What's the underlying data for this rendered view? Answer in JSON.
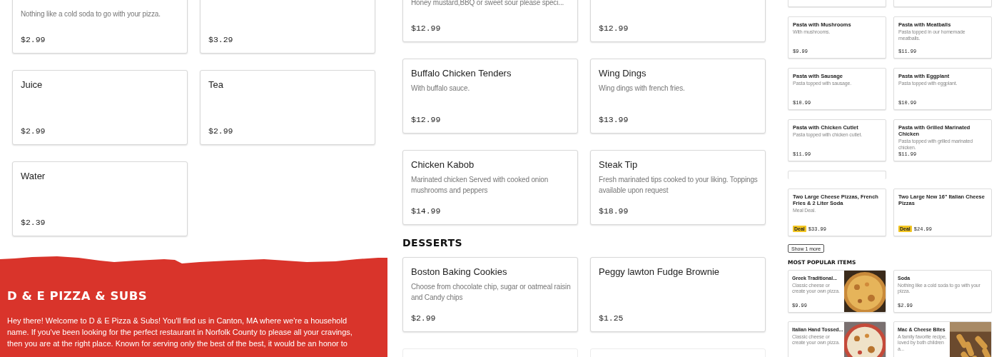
{
  "left": {
    "items": [
      {
        "description": "Nothing like a cold soda to go with your pizza.",
        "price": "$2.99"
      },
      {
        "price": "$3.29"
      },
      {
        "name": "Juice",
        "price": "$2.99"
      },
      {
        "name": "Tea",
        "price": "$2.99"
      },
      {
        "name": "Water",
        "price": "$2.39"
      }
    ],
    "about": {
      "title": "D & E PIZZA & SUBS",
      "text": "Hey there! Welcome to D & E Pizza & Subs! You'll find us in Canton, MA where we're a household name. If you've been looking for the perfect restaurant in Norfolk County to please all your cravings, then you are at the right place. Known for serving only the best of the best, it would be an honor to"
    }
  },
  "middle": {
    "groups": [
      {
        "items": [
          {
            "description": "Honey mustard,BBQ or sweet sour please speci...",
            "price": "$12.99"
          },
          {
            "price": "$12.99"
          },
          {
            "name": "Buffalo Chicken Tenders",
            "description": "With buffalo sauce.",
            "price": "$12.99"
          },
          {
            "name": "Wing Dings",
            "description": "Wing dings with french fries.",
            "price": "$13.99"
          },
          {
            "name": "Chicken Kabob",
            "description": "Marinated chicken Served with cooked onion mushrooms and peppers",
            "price": "$14.99"
          },
          {
            "name": "Steak Tip",
            "description": "Fresh marinated tips cooked to your liking. Toppings available upon request",
            "price": "$18.99"
          }
        ]
      },
      {
        "heading": "DESSERTS",
        "items": [
          {
            "name": "Boston Baking Cookies",
            "description": "Choose from chocolate chip, sugar or oatmeal raisin and Candy chips",
            "price": "$2.99"
          },
          {
            "name": "Peggy lawton Fudge Brownie",
            "price": "$1.25"
          },
          {
            "kind": "stub"
          },
          {
            "kind": "stub"
          }
        ]
      }
    ]
  },
  "right": {
    "items": [
      {
        "kind": "stub"
      },
      {
        "kind": "stub"
      },
      {
        "kind": "item",
        "name": "Pasta with Mushrooms",
        "description": "With mushrooms.",
        "price": "$9.99"
      },
      {
        "kind": "item",
        "name": "Pasta with Meatballs",
        "description": "Pasta topped in our homemade meatballs.",
        "price": "$11.99"
      },
      {
        "kind": "item",
        "name": "Pasta with Sausage",
        "description": "Pasta topped with sausage.",
        "price": "$10.99"
      },
      {
        "kind": "item",
        "name": "Pasta with Eggplant",
        "description": "Pasta topped with eggplant.",
        "price": "$10.99"
      },
      {
        "kind": "item",
        "name": "Pasta with Chicken Cutlet",
        "description": "Pasta topped with chicken cutlet.",
        "price": "$11.99"
      },
      {
        "kind": "item",
        "name": "Pasta with Grilled Marinated Chicken",
        "description": "Pasta topped with grilled marinated chicken.",
        "price": "$11.99"
      },
      {
        "kind": "stub"
      }
    ],
    "deals": [
      {
        "name": "Two Large Cheese Pizzas, French Fries & 2 Liter Soda",
        "description": "Meal Deal.",
        "badge": "Deal",
        "price": "$33.99"
      },
      {
        "name": "Two Large New 16\" Italian Cheese Pizzas",
        "badge": "Deal",
        "price": "$24.99"
      }
    ],
    "show_more": "Show 1 more",
    "popular": {
      "title": "MOST POPULAR ITEMS",
      "items": [
        {
          "name": "Greek Traditional...",
          "description": "Classic cheese or create your own pizza.",
          "price": "$9.99"
        },
        {
          "name": "Soda",
          "description": "Nothing like a cold soda to go with your pizza.",
          "price": "$2.99"
        },
        {
          "name": "Italian Hand Tossed...",
          "description": "Classic cheese or create your own pizza."
        },
        {
          "name": "Mac & Cheese Bites",
          "description": "A family favorite recipe, loved by both children a..."
        }
      ]
    }
  }
}
